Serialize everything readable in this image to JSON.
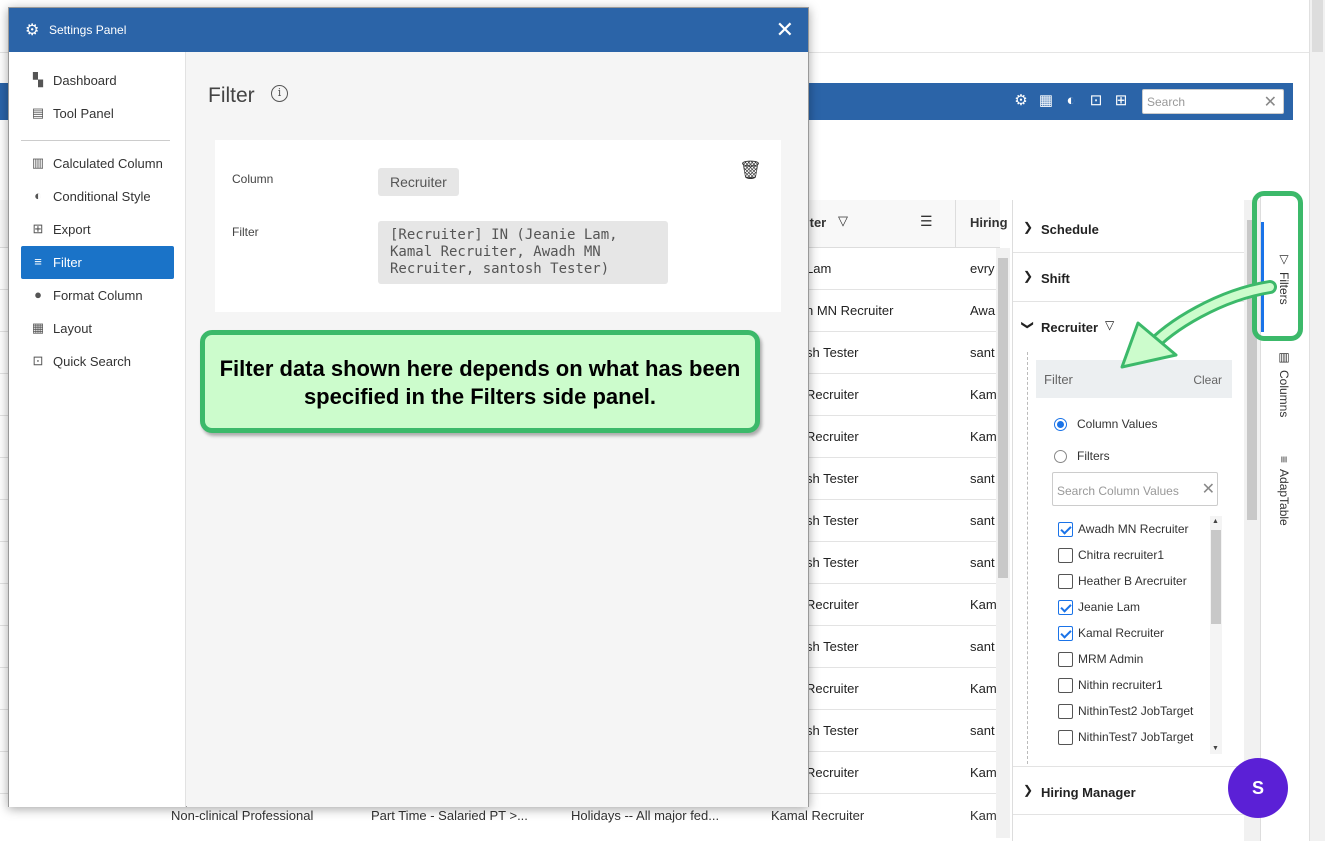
{
  "background_app": {
    "search_placeholder": "Search",
    "toolbar_icons": [
      "gear-icon",
      "grid-icon",
      "theme-drop-icon",
      "quick-search-icon",
      "export-icon"
    ],
    "grid_header": {
      "recruiter": "iter",
      "hiring": "Hiring"
    },
    "rows": [
      {
        "c1": "Lam",
        "c2": "evry"
      },
      {
        "c1": "n MN Recruiter",
        "c2": "Awa"
      },
      {
        "c1": "sh Tester",
        "c2": "sant"
      },
      {
        "c1": "Recruiter",
        "c2": "Kam"
      },
      {
        "c1": "Recruiter",
        "c2": "Kam"
      },
      {
        "c1": "sh Tester",
        "c2": "sant"
      },
      {
        "c1": "sh Tester",
        "c2": "sant"
      },
      {
        "c1": "sh Tester",
        "c2": "sant"
      },
      {
        "c1": "Recruiter",
        "c2": "Kam"
      },
      {
        "c1": "sh Tester",
        "c2": "sant"
      },
      {
        "c1": "Recruiter",
        "c2": "Kam"
      },
      {
        "c1": "sh Tester",
        "c2": "sant"
      },
      {
        "c1": "Recruiter",
        "c2": "Kam"
      }
    ],
    "bottom_row": {
      "a": "Non-clinical Professional",
      "b": "Part Time - Salaried PT >...",
      "c": "Holidays -- All major fed...",
      "d": "Kamal Recruiter",
      "e": "Kam"
    }
  },
  "sidebar": {
    "sections": {
      "schedule": "Schedule",
      "shift": "Shift",
      "recruiter": "Recruiter",
      "hiring_manager": "Hiring Manager"
    },
    "filter_bar": {
      "label": "Filter",
      "clear": "Clear"
    },
    "radio": {
      "column_values": "Column Values",
      "filters": "Filters"
    },
    "search_placeholder": "Search Column Values",
    "values": [
      {
        "label": "Awadh MN Recruiter",
        "checked": true
      },
      {
        "label": "Chitra recruiter1",
        "checked": false
      },
      {
        "label": "Heather B Arecruiter",
        "checked": false
      },
      {
        "label": "Jeanie Lam",
        "checked": true
      },
      {
        "label": "Kamal Recruiter",
        "checked": true
      },
      {
        "label": "MRM Admin",
        "checked": false
      },
      {
        "label": "Nithin recruiter1",
        "checked": false
      },
      {
        "label": "NithinTest2 JobTarget",
        "checked": false
      },
      {
        "label": "NithinTest7 JobTarget",
        "checked": false
      }
    ]
  },
  "side_tabs": {
    "filters": "Filters",
    "columns": "Columns",
    "adaptable": "AdapTable"
  },
  "fab_label": "S",
  "modal": {
    "title": "Settings Panel",
    "nav": [
      {
        "label": "Dashboard",
        "icon": "dashboard-icon"
      },
      {
        "label": "Tool Panel",
        "icon": "clipboard-icon"
      },
      {
        "label": "Calculated Column",
        "icon": "calculated-column-icon"
      },
      {
        "label": "Conditional Style",
        "icon": "drop-icon"
      },
      {
        "label": "Export",
        "icon": "export-icon"
      },
      {
        "label": "Filter",
        "icon": "filter-icon"
      },
      {
        "label": "Format Column",
        "icon": "palette-icon"
      },
      {
        "label": "Layout",
        "icon": "grid-icon"
      },
      {
        "label": "Quick Search",
        "icon": "quick-search-icon"
      }
    ],
    "active_nav": "Filter",
    "main": {
      "title": "Filter",
      "column_label": "Column",
      "column_value": "Recruiter",
      "filter_label": "Filter",
      "filter_value": "[Recruiter] IN (Jeanie Lam, Kamal Recruiter, Awadh MN Recruiter, santosh Tester)"
    }
  },
  "callout": "Filter data shown here depends on what has been specified in the Filters side panel.",
  "colors": {
    "header_blue": "#2b64a8",
    "active_nav": "#1a73c8",
    "callout_border": "#3cb96a",
    "callout_fill": "#ccfccc",
    "fab": "#5b20d6"
  }
}
